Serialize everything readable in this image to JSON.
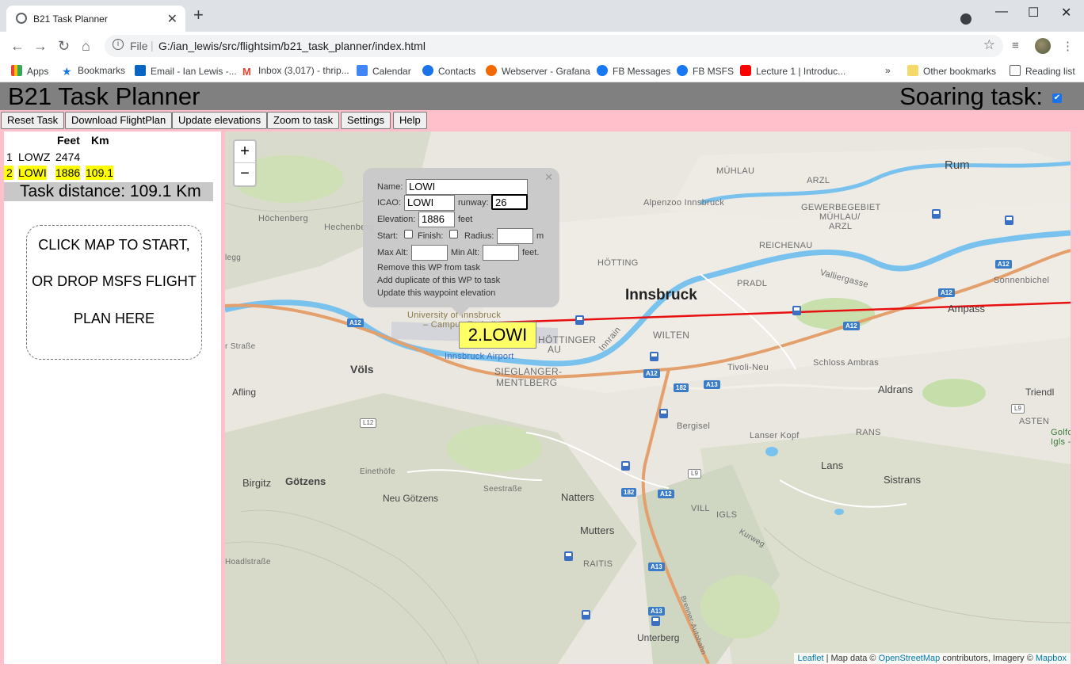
{
  "browser": {
    "tab_title": "B21 Task Planner",
    "scheme": "File",
    "url": "G:/ian_lewis/src/flightsim/b21_task_planner/index.html",
    "bookmarks": [
      "Apps",
      "Bookmarks",
      "Email - Ian Lewis -...",
      "Inbox (3,017) - thrip...",
      "Calendar",
      "Contacts",
      "Webserver - Grafana",
      "FB Messages",
      "FB MSFS",
      "Lecture 1 | Introduc...",
      "»",
      "Other bookmarks",
      "Reading list"
    ]
  },
  "app": {
    "title": "B21 Task Planner",
    "soaring_label": "Soaring task:",
    "soaring_checked": true,
    "buttons": [
      "Reset Task",
      "Download FlightPlan",
      "Update elevations",
      "Zoom to task",
      "Settings",
      "Help"
    ]
  },
  "task": {
    "headers": {
      "feet": "Feet",
      "km": "Km"
    },
    "waypoints": [
      {
        "num": "1",
        "name": "LOWZ",
        "feet": "2474",
        "km": ""
      },
      {
        "num": "2",
        "name": "LOWI",
        "feet": "1886",
        "km": "109.1"
      }
    ],
    "distance": "Task distance: 109.1 Km",
    "dropzone": [
      "CLICK MAP TO START,",
      "OR DROP MSFS FLIGHT",
      "PLAN HERE"
    ]
  },
  "popup": {
    "name_label": "Name:",
    "name_value": "LOWI",
    "icao_label": "ICAO:",
    "icao_value": "LOWI",
    "runway_label": "runway:",
    "runway_value": "26",
    "elevation_label": "Elevation:",
    "elevation_value": "1886",
    "feet": "feet",
    "start_label": "Start:",
    "finish_label": "Finish:",
    "radius_label": "Radius:",
    "m": "m",
    "maxalt_label": "Max Alt:",
    "minalt_label": "Min Alt:",
    "feet2": "feet.",
    "actions": [
      "Remove this WP from task",
      "Add duplicate of this WP to task",
      "Update this waypoint elevation"
    ]
  },
  "map": {
    "waypoint_label": "2.LOWI",
    "zoom_in": "+",
    "zoom_out": "−",
    "attribution": {
      "leaflet": "Leaflet",
      "data": " | Map data © ",
      "osm": "OpenStreetMap",
      "contrib": " contributors, Imagery © ",
      "mapbox": "Mapbox"
    },
    "places": {
      "innsbruck": "Innsbruck",
      "rum": "Rum",
      "muhlau": "MÜHLAU",
      "arzl": "ARZL",
      "alpenzoo": "Alpenzoo Innsbruck",
      "gewerbe1": "GEWERBEGEBIET",
      "gewerbe2": "MÜHLAU/",
      "gewerbe3": "ARZL",
      "hochenberg": "Höchenberg",
      "hechenberg": "Hechenberg",
      "reichenau": "REICHENAU",
      "hotting": "HÖTTING",
      "pradl": "PRADL",
      "valliergasse": "Valliergasse",
      "sonnenbichel": "Sonnenbichel",
      "ampass": "Ampass",
      "university1": "University of Innsbruck",
      "university2": "– Campus Technik",
      "hottinger1": "HÖTTINGER",
      "hottinger2": "AU",
      "innrain": "Innrain",
      "wilten": "WILTEN",
      "airport": "Innsbruck Airport",
      "vols": "Völs",
      "siegl1": "SIEGLANGER-",
      "siegl2": "MENTLBERG",
      "tivoli": "Tivoli-Neu",
      "ambras": "Schloss Ambras",
      "afling": "Afling",
      "aldrans": "Aldrans",
      "triendl": "Triendl",
      "bergisel": "Bergisel",
      "lanserkopf": "Lanser Kopf",
      "rans": "RANS",
      "asten": "ASTEN",
      "golfclub": "Golfc",
      "igls_short": "Igls -",
      "birgitz": "Birgitz",
      "gotzens": "Götzens",
      "einethofe": "Einethöfe",
      "seestrasse": "Seestraße",
      "neugotzens": "Neu Götzens",
      "natters": "Natters",
      "vill": "VILL",
      "lans": "Lans",
      "sistrans": "Sistrans",
      "igls": "IGLS",
      "mutters": "Mutters",
      "kurweg": "Kurweg",
      "raitis": "RAITIS",
      "unterberg": "Unterberg",
      "hoadl": "Hoadlstraße",
      "strasse_left": "r Straße",
      "legg": "legg",
      "brenner": "Brenner-Autobahn"
    },
    "roads": [
      "A12",
      "A12",
      "A12",
      "A12",
      "A12",
      "A12",
      "A13",
      "A13",
      "A13",
      "182",
      "182",
      "L12",
      "L9",
      "L9"
    ]
  }
}
